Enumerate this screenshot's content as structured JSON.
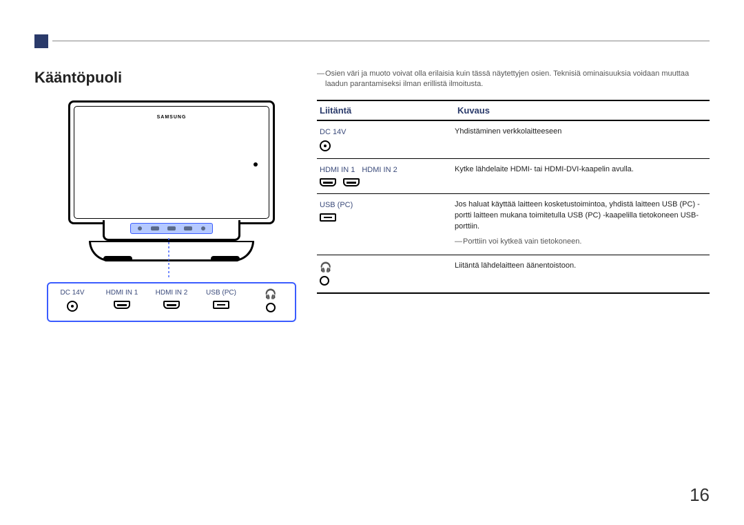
{
  "section_title": "Kääntöpuoli",
  "brand_logo": "SAMSUNG",
  "note_dash": "―",
  "top_note": "Osien väri ja muoto voivat olla erilaisia kuin tässä näytettyjen osien. Teknisiä ominaisuuksia voidaan muuttaa laadun parantamiseksi ilman erillistä ilmoitusta.",
  "table": {
    "head": {
      "liitanta": "Liitäntä",
      "kuvaus": "Kuvaus"
    },
    "rows": {
      "dc": {
        "label": "DC 14V",
        "desc": "Yhdistäminen verkkolaitteeseen"
      },
      "hdmi": {
        "label1": "HDMI IN 1",
        "label2": "HDMI IN 2",
        "desc": "Kytke lähdelaite HDMI- tai HDMI-DVI-kaapelin avulla."
      },
      "usb": {
        "label": "USB (PC)",
        "desc": "Jos haluat käyttää laitteen kosketustoimintoa, yhdistä laitteen USB (PC) -portti laitteen mukana toimitetulla USB (PC) -kaapelilla tietokoneen USB-porttiin.",
        "subnote": "Porttiin voi kytkeä vain tietokoneen."
      },
      "hp": {
        "desc": "Liitäntä lähdelaitteen äänentoistoon."
      }
    }
  },
  "port_panel": {
    "dc": "DC 14V",
    "hdmi1": "HDMI IN 1",
    "hdmi2": "HDMI IN 2",
    "usb": "USB (PC)",
    "hp_icon": "🎧"
  },
  "page_number": "16"
}
